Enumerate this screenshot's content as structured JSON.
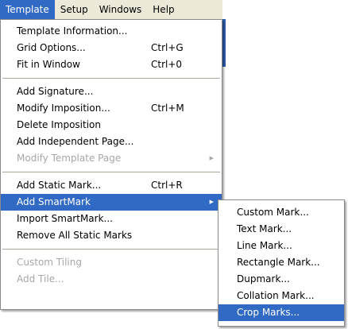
{
  "menubar": {
    "items": [
      {
        "label": "Template",
        "active": true
      },
      {
        "label": "Setup"
      },
      {
        "label": "Windows"
      },
      {
        "label": "Help"
      }
    ]
  },
  "main_menu": {
    "items": [
      {
        "label": "Template Information...",
        "shortcut": ""
      },
      {
        "label": "Grid Options...",
        "shortcut": "Ctrl+G"
      },
      {
        "label": "Fit in Window",
        "shortcut": "Ctrl+0"
      },
      {
        "label": "Add Signature...",
        "shortcut": ""
      },
      {
        "label": "Modify Imposition...",
        "shortcut": "Ctrl+M"
      },
      {
        "label": "Delete Imposition",
        "shortcut": ""
      },
      {
        "label": "Add Independent Page...",
        "shortcut": ""
      },
      {
        "label": "Modify Template Page",
        "shortcut": "",
        "arrow": "▶"
      },
      {
        "label": "Add Static Mark...",
        "shortcut": "Ctrl+R"
      },
      {
        "label": "Add SmartMark",
        "shortcut": "",
        "arrow": "▶"
      },
      {
        "label": "Import SmartMark...",
        "shortcut": ""
      },
      {
        "label": "Remove All Static Marks",
        "shortcut": ""
      },
      {
        "label": "Custom Tiling",
        "shortcut": ""
      },
      {
        "label": "Add Tile...",
        "shortcut": ""
      }
    ]
  },
  "submenu": {
    "items": [
      {
        "label": "Custom Mark..."
      },
      {
        "label": "Text Mark..."
      },
      {
        "label": "Line Mark..."
      },
      {
        "label": "Rectangle Mark..."
      },
      {
        "label": "Dupmark..."
      },
      {
        "label": "Collation Mark..."
      },
      {
        "label": "Crop Marks..."
      }
    ]
  },
  "colors": {
    "highlight": "#316ac5",
    "menubar": "#ece9d8",
    "disabled_text": "#a7a6aa"
  }
}
